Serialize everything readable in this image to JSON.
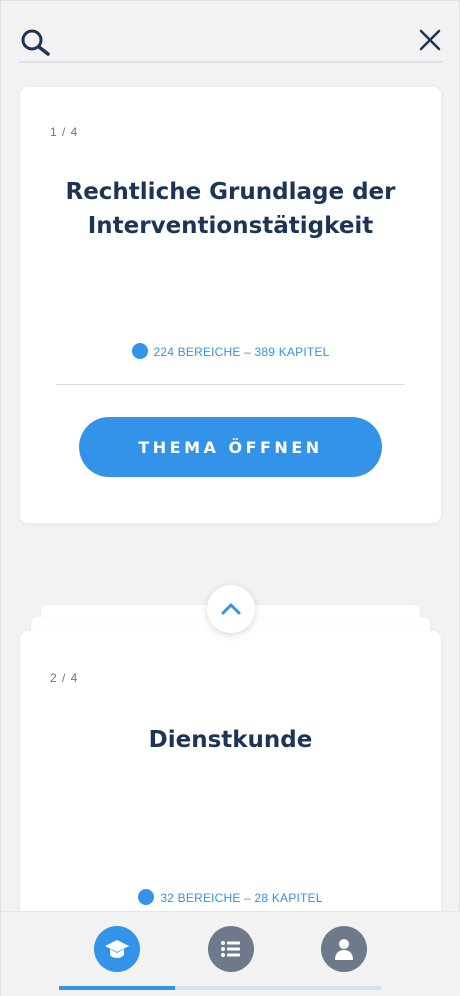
{
  "search": {
    "placeholder": "",
    "icon": "search-icon",
    "close_icon": "close-icon"
  },
  "cards": [
    {
      "counter": "1 / 4",
      "title": "Rechtliche Grundlage der Interventionstätigkeit",
      "meta": "224 BEREICHE – 389 KAPITEL",
      "button_label": "THEMA ÖFFNEN"
    },
    {
      "counter": "2 / 4",
      "title": "Dienstkunde",
      "meta": "32 BEREICHE – 28 KAPITEL"
    }
  ],
  "nav": {
    "items": [
      {
        "icon": "graduation-cap-icon",
        "active": true
      },
      {
        "icon": "list-icon",
        "active": false
      },
      {
        "icon": "user-icon",
        "active": false
      }
    ]
  },
  "colors": {
    "accent": "#3393e8",
    "title": "#1c3557",
    "inactive_nav": "#6e7a8a",
    "background": "#f2f2f3"
  }
}
